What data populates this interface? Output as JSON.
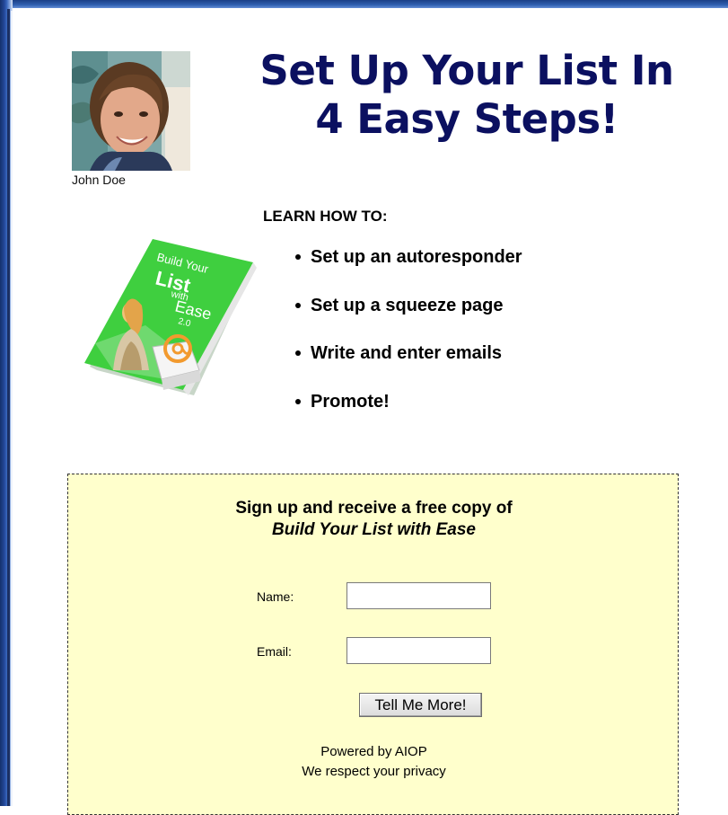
{
  "header": {
    "headline_line1": "Set Up Your List In",
    "headline_line2": "4 Easy Steps!"
  },
  "author": {
    "name": "John Doe",
    "avatar_icon": "author-photo-icon"
  },
  "product": {
    "cover_icon": "ebook-cover-icon",
    "cover_title_line1": "Build Your",
    "cover_title_line2": "List",
    "cover_title_line3": "with",
    "cover_title_line4": "Ease",
    "cover_version": "2.0"
  },
  "learn": {
    "label": "LEARN HOW TO:",
    "items": [
      "Set up an autoresponder",
      "Set up a squeeze page",
      "Write and enter emails",
      "Promote!"
    ]
  },
  "optin": {
    "headline": "Sign up and receive a free copy of",
    "product_name": "Build Your List with Ease",
    "name_label": "Name:",
    "name_value": "",
    "email_label": "Email:",
    "email_value": "",
    "submit_label": "Tell Me More!",
    "powered_by": "Powered by AIOP",
    "privacy": "We respect your privacy",
    "background_color": "#ffffcc"
  },
  "colors": {
    "headline": "#0b1060",
    "frame": "#23489a"
  }
}
